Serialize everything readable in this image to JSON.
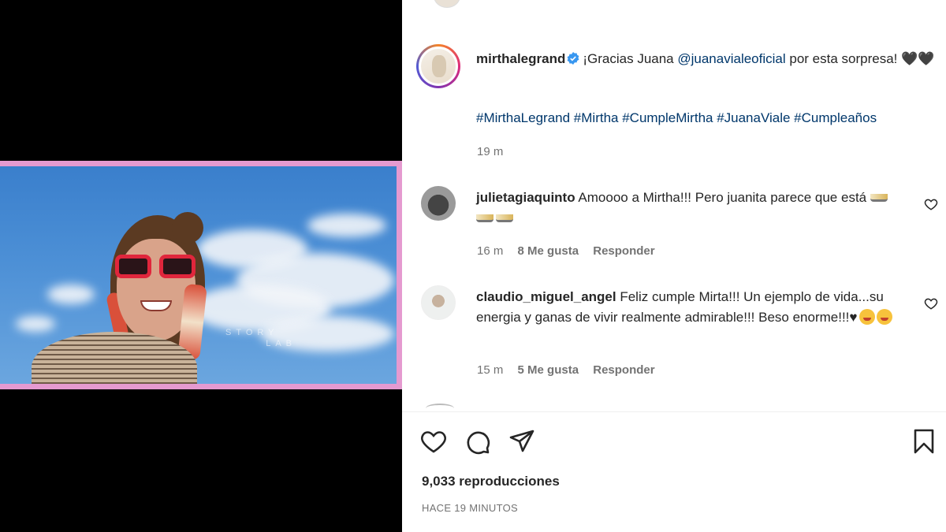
{
  "post": {
    "username": "mirthalegrand",
    "caption_text": "¡Gracias Juana ",
    "caption_mention": "@juanavialeoficial",
    "caption_rest": " por esta sorpresa! 🖤🖤",
    "hashtags": "#MirthaLegrand #Mirtha #CumpleMirtha #JuanaViale #Cumpleaños",
    "time": "19 m"
  },
  "video": {
    "watermark_line1": "STORY",
    "watermark_line2": "LAB"
  },
  "comments": [
    {
      "username": "julietagiaquinto",
      "text": "Amoooo a Mirtha!!! Pero juanita parece que está",
      "time": "16 m",
      "likes": "8 Me gusta",
      "reply": "Responder"
    },
    {
      "username": "claudio_miguel_angel",
      "text": "Feliz cumple Mirta!!! Un ejemplo de vida...su energia y ganas de vivir realmente admirable!!! Beso enorme!!!♥",
      "time": "15 m",
      "likes": "5 Me gusta",
      "reply": "Responder"
    }
  ],
  "stats": {
    "views": "9,033 reproducciones",
    "timestamp": "HACE 19 MINUTOS"
  },
  "icons": [
    "verified-badge-icon",
    "heart-icon",
    "comment-icon",
    "share-icon",
    "bookmark-icon"
  ],
  "colors": {
    "video_border": "#e59ad0",
    "link": "#00376b",
    "verified": "#3897f0",
    "muted": "#737373"
  }
}
